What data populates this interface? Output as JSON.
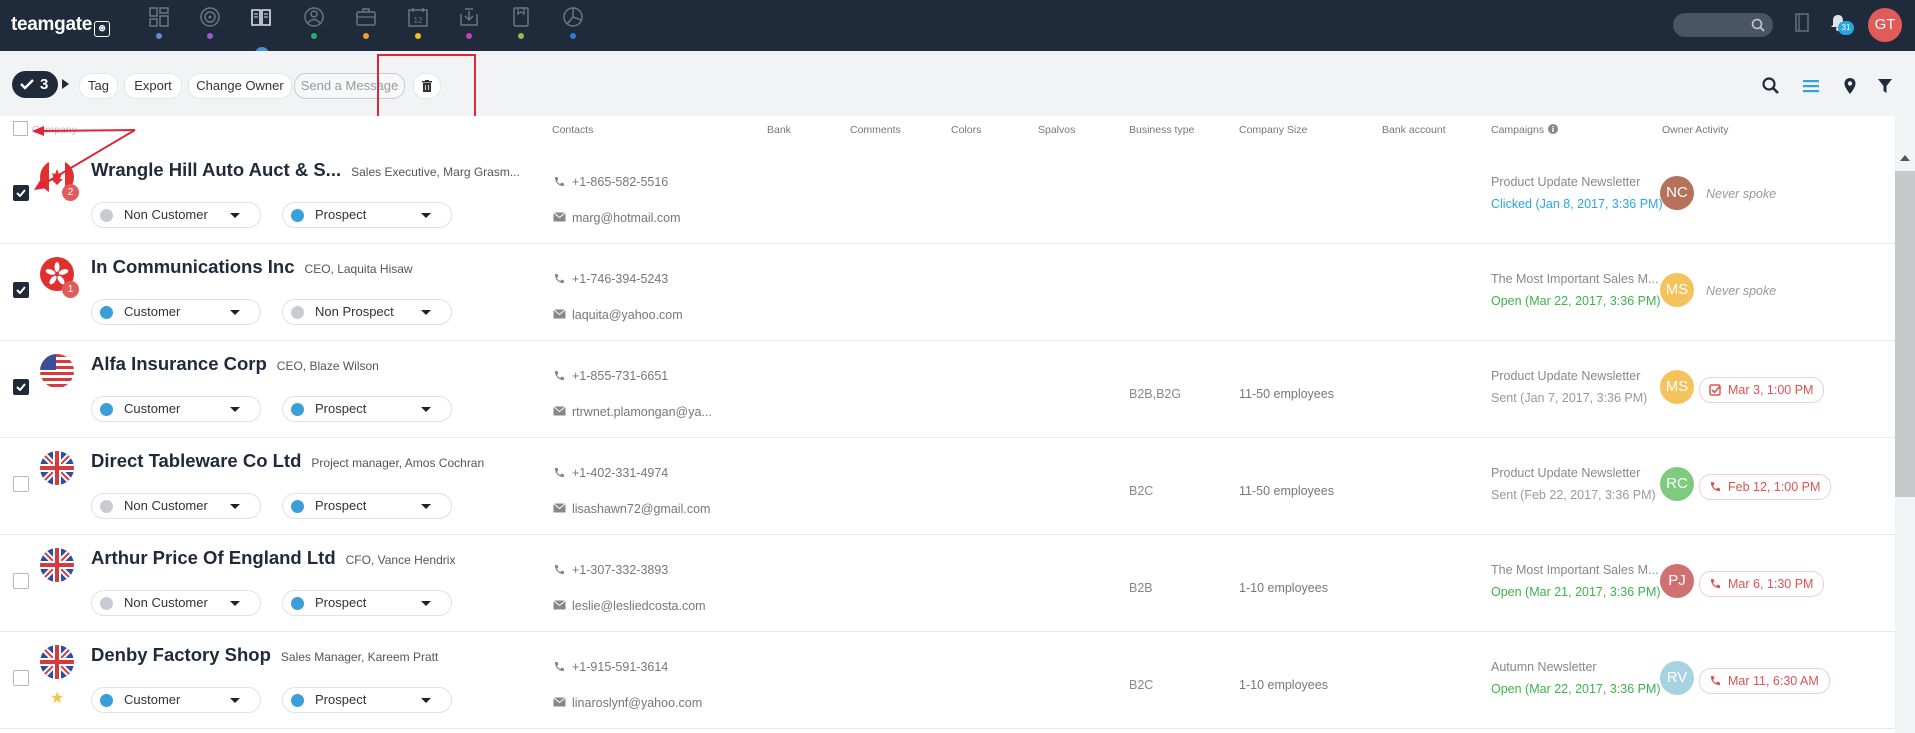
{
  "app": {
    "logo": "teamgate",
    "logo_mark": "⊛"
  },
  "topbar": {
    "nav_icons": [
      {
        "name": "dashboard-icon",
        "dot": "#5b8dd6"
      },
      {
        "name": "target-icon",
        "dot": "#9b59d0"
      },
      {
        "name": "book-icon",
        "dot": ""
      },
      {
        "name": "people-icon",
        "dot": "#20b16e"
      },
      {
        "name": "briefcase-icon",
        "dot": "#f39c3b"
      },
      {
        "name": "calendar-icon",
        "dot": "#f1c40f"
      },
      {
        "name": "inbox-icon",
        "dot": "#c144b8"
      },
      {
        "name": "document-icon",
        "dot": "#8bc34a"
      },
      {
        "name": "chart-icon",
        "dot": "#2c7bd8"
      }
    ],
    "calendar_day": "12",
    "notifications_count": "31",
    "user_initials": "GT"
  },
  "toolbar": {
    "selected_count": "3",
    "tag": "Tag",
    "export": "Export",
    "change_owner": "Change Owner",
    "send_message": "Send a Message"
  },
  "columns": {
    "company": "Company",
    "contacts": "Contacts",
    "bank": "Bank",
    "comments": "Comments",
    "colors": "Colors",
    "spalvos": "Spalvos",
    "business_type": "Business type",
    "company_size": "Company Size",
    "bank_account": "Bank account",
    "campaigns": "Campaigns",
    "owner_activity": "Owner Activity"
  },
  "rows": [
    {
      "checked": true,
      "flag": "ca",
      "flag_badge": "2",
      "starred": false,
      "name": "Wrangle Hill Auto Auct & S...",
      "sub": "Sales Executive, Marg Grasm...",
      "status1": "Non Customer",
      "status1_color": "#c8ccd2",
      "status2": "Prospect",
      "status2_color": "#3a9fd8",
      "phone": "+1-865-582-5516",
      "email": "marg@hotmail.com",
      "business_type": "",
      "company_size": "",
      "campaign": "Product Update Newsletter",
      "campaign_status": "Clicked (Jan 8, 2017, 3:36 PM)",
      "campaign_status_color": "#2aa5e0",
      "owner": "NC",
      "owner_color": "#b5715a",
      "activity_type": "never",
      "activity": "Never spoke"
    },
    {
      "checked": true,
      "flag": "hk",
      "flag_badge": "1",
      "starred": false,
      "name": "In Communications Inc",
      "sub": "CEO, Laquita Hisaw",
      "status1": "Customer",
      "status1_color": "#3a9fd8",
      "status2": "Non Prospect",
      "status2_color": "#c8ccd2",
      "phone": "+1-746-394-5243",
      "email": "laquita@yahoo.com",
      "business_type": "",
      "company_size": "",
      "campaign": "The Most Important Sales M...",
      "campaign_status": "Open (Mar 22, 2017, 3:36 PM)",
      "campaign_status_color": "#3cb34a",
      "owner": "MS",
      "owner_color": "#f5c35b",
      "activity_type": "never",
      "activity": "Never spoke"
    },
    {
      "checked": true,
      "flag": "us",
      "flag_badge": "",
      "starred": false,
      "name": "Alfa Insurance Corp",
      "sub": "CEO, Blaze Wilson",
      "status1": "Customer",
      "status1_color": "#3a9fd8",
      "status2": "Prospect",
      "status2_color": "#3a9fd8",
      "phone": "+1-855-731-6651",
      "email": "rtrwnet.plamongan@ya...",
      "business_type": "B2B,B2G",
      "company_size": "11-50 employees",
      "campaign": "Product Update Newsletter",
      "campaign_status": "Sent (Jan 7, 2017, 3:36 PM)",
      "campaign_status_color": "#999999",
      "owner": "MS",
      "owner_color": "#f5c35b",
      "activity_type": "task",
      "activity": "Mar 3, 1:00 PM"
    },
    {
      "checked": false,
      "flag": "gb",
      "flag_badge": "",
      "starred": false,
      "name": "Direct Tableware Co Ltd",
      "sub": "Project manager, Amos Cochran",
      "status1": "Non Customer",
      "status1_color": "#c8ccd2",
      "status2": "Prospect",
      "status2_color": "#3a9fd8",
      "phone": "+1-402-331-4974",
      "email": "lisashawn72@gmail.com",
      "business_type": "B2C",
      "company_size": "11-50 employees",
      "campaign": "Product Update Newsletter",
      "campaign_status": "Sent (Feb 22, 2017, 3:36 PM)",
      "campaign_status_color": "#999999",
      "owner": "RC",
      "owner_color": "#7ecb7e",
      "activity_type": "call",
      "activity": "Feb 12, 1:00 PM"
    },
    {
      "checked": false,
      "flag": "gb",
      "flag_badge": "",
      "starred": false,
      "name": "Arthur Price Of England Ltd",
      "sub": "CFO, Vance Hendrix",
      "status1": "Non Customer",
      "status1_color": "#c8ccd2",
      "status2": "Prospect",
      "status2_color": "#3a9fd8",
      "phone": "+1-307-332-3893",
      "email": "leslie@lesliedcosta.com",
      "business_type": "B2B",
      "company_size": "1-10 employees",
      "campaign": "The Most Important Sales M...",
      "campaign_status": "Open (Mar 21, 2017, 3:36 PM)",
      "campaign_status_color": "#3cb34a",
      "owner": "PJ",
      "owner_color": "#d07070",
      "activity_type": "call",
      "activity": "Mar 6, 1:30 PM"
    },
    {
      "checked": false,
      "flag": "gb",
      "flag_badge": "",
      "starred": true,
      "name": "Denby Factory Shop",
      "sub": "Sales Manager, Kareem Pratt",
      "status1": "Customer",
      "status1_color": "#3a9fd8",
      "status2": "Prospect",
      "status2_color": "#3a9fd8",
      "phone": "+1-915-591-3614",
      "email": "linaroslynf@yahoo.com",
      "business_type": "B2C",
      "company_size": "1-10 employees",
      "campaign": "Autumn Newsletter",
      "campaign_status": "Open (Mar 22, 2017, 3:36 PM)",
      "campaign_status_color": "#3cb34a",
      "owner": "RV",
      "owner_color": "#a5d4e0",
      "activity_type": "call",
      "activity": "Mar 11, 6:30 AM"
    }
  ]
}
